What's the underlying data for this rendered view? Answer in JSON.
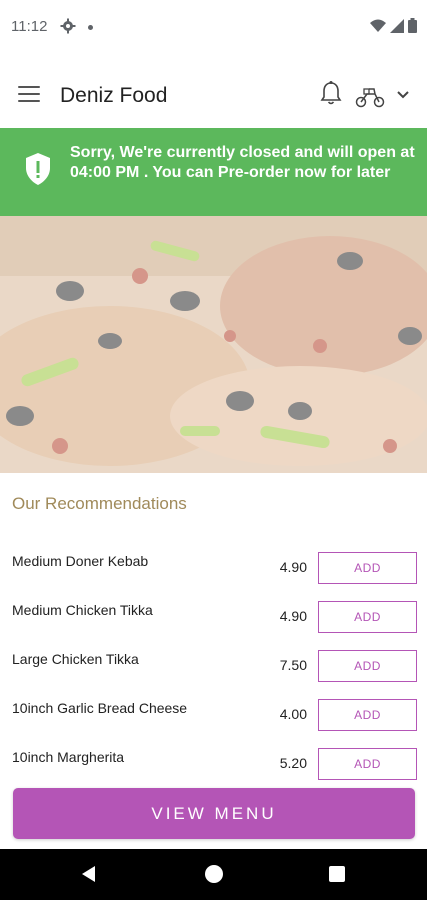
{
  "status_bar": {
    "time": "11:12",
    "icons": [
      "gear-icon",
      "dot-icon",
      "wifi-icon",
      "signal-icon",
      "battery-icon"
    ]
  },
  "app_bar": {
    "title": "Deniz Food",
    "icons": [
      "menu-icon",
      "bell-icon",
      "scooter-icon",
      "chevron-down-icon"
    ]
  },
  "notice": {
    "text": "Sorry, We're currently closed and will open at 04:00 PM . You can Pre-order now for later",
    "icon": "shield-icon",
    "color": "#5cb85c"
  },
  "recommendations": {
    "title": "Our Recommendations",
    "add_label": "ADD",
    "items": [
      {
        "name": "Medium Doner Kebab",
        "price": "4.90"
      },
      {
        "name": "Medium Chicken Tikka",
        "price": "4.90"
      },
      {
        "name": "Large Chicken Tikka",
        "price": "7.50"
      },
      {
        "name": "10inch Garlic Bread Cheese",
        "price": "4.00"
      },
      {
        "name": "10inch Margherita",
        "price": "5.20"
      }
    ]
  },
  "view_menu": {
    "label": "VIEW MENU",
    "color": "#b455b6"
  },
  "nav_bar": {
    "icons": [
      "back-icon",
      "home-icon",
      "recents-icon"
    ]
  }
}
